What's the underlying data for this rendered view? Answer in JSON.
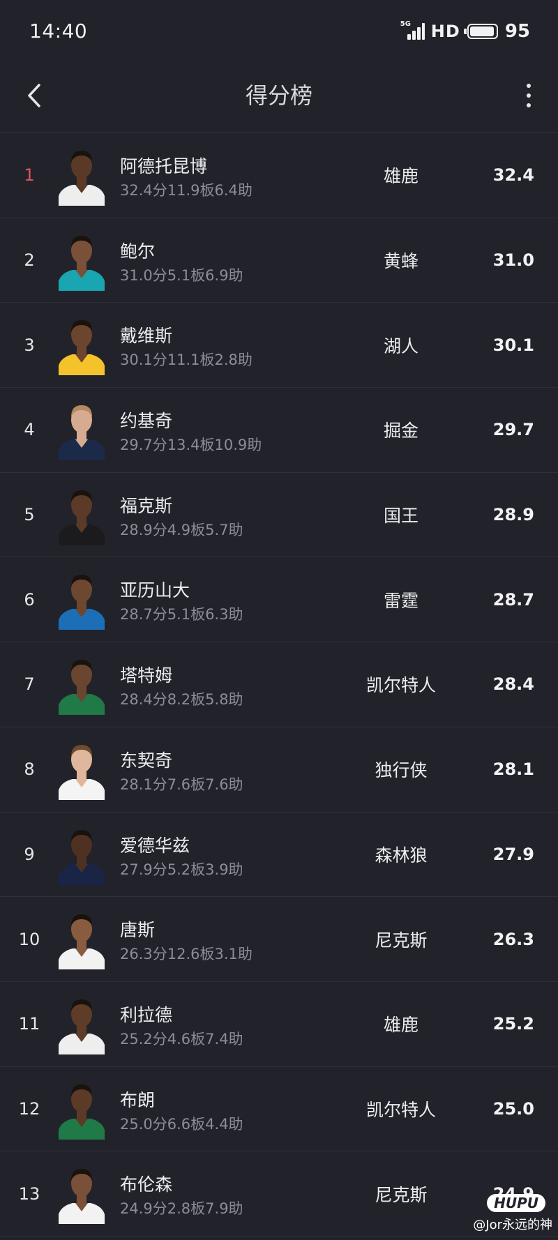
{
  "status_bar": {
    "time": "14:40",
    "network": "5G",
    "hd": "HD",
    "battery": "95"
  },
  "header": {
    "title": "得分榜"
  },
  "players": [
    {
      "rank": "1",
      "name": "阿德托昆博",
      "stats": "32.4分11.9板6.4助",
      "team": "雄鹿",
      "value": "32.4",
      "jersey": "#eeeeee",
      "skin": "#5a3a27",
      "hair": "#1a120d"
    },
    {
      "rank": "2",
      "name": "鲍尔",
      "stats": "31.0分5.1板6.9助",
      "team": "黄蜂",
      "value": "31.0",
      "jersey": "#1aa6b0",
      "skin": "#7a5138",
      "hair": "#1a120d"
    },
    {
      "rank": "3",
      "name": "戴维斯",
      "stats": "30.1分11.1板2.8助",
      "team": "湖人",
      "value": "30.1",
      "jersey": "#f4c22b",
      "skin": "#6b452e",
      "hair": "#1a120d"
    },
    {
      "rank": "4",
      "name": "约基奇",
      "stats": "29.7分13.4板10.9助",
      "team": "掘金",
      "value": "29.7",
      "jersey": "#1c2a4a",
      "skin": "#d7ab91",
      "hair": "#b48a62"
    },
    {
      "rank": "5",
      "name": "福克斯",
      "stats": "28.9分4.9板5.7助",
      "team": "国王",
      "value": "28.9",
      "jersey": "#1b1b1d",
      "skin": "#5b3a27",
      "hair": "#1a120d"
    },
    {
      "rank": "6",
      "name": "亚历山大",
      "stats": "28.7分5.1板6.3助",
      "team": "雷霆",
      "value": "28.7",
      "jersey": "#1c6fb6",
      "skin": "#6d472f",
      "hair": "#1a120d"
    },
    {
      "rank": "7",
      "name": "塔特姆",
      "stats": "28.4分8.2板5.8助",
      "team": "凯尔特人",
      "value": "28.4",
      "jersey": "#1f7a47",
      "skin": "#6a4530",
      "hair": "#1a120d"
    },
    {
      "rank": "8",
      "name": "东契奇",
      "stats": "28.1分7.6板7.6助",
      "team": "独行侠",
      "value": "28.1",
      "jersey": "#f4f4f4",
      "skin": "#e0b79c",
      "hair": "#6e4a2e"
    },
    {
      "rank": "9",
      "name": "爱德华兹",
      "stats": "27.9分5.2板3.9助",
      "team": "森林狼",
      "value": "27.9",
      "jersey": "#1a2446",
      "skin": "#4e3122",
      "hair": "#1a120d"
    },
    {
      "rank": "10",
      "name": "唐斯",
      "stats": "26.3分12.6板3.1助",
      "team": "尼克斯",
      "value": "26.3",
      "jersey": "#f2f2f2",
      "skin": "#8a5c3f",
      "hair": "#1a120d"
    },
    {
      "rank": "11",
      "name": "利拉德",
      "stats": "25.2分4.6板7.4助",
      "team": "雄鹿",
      "value": "25.2",
      "jersey": "#eeeeee",
      "skin": "#5e3c28",
      "hair": "#1a120d"
    },
    {
      "rank": "12",
      "name": "布朗",
      "stats": "25.0分6.6板4.4助",
      "team": "凯尔特人",
      "value": "25.0",
      "jersey": "#1f7a47",
      "skin": "#5b3a27",
      "hair": "#1a120d"
    },
    {
      "rank": "13",
      "name": "布伦森",
      "stats": "24.9分2.8板7.9助",
      "team": "尼克斯",
      "value": "24.9",
      "jersey": "#f2f2f2",
      "skin": "#7b5038",
      "hair": "#1a120d"
    }
  ],
  "watermark": {
    "logo": "HUPU",
    "text": "@Jor永远的神"
  }
}
